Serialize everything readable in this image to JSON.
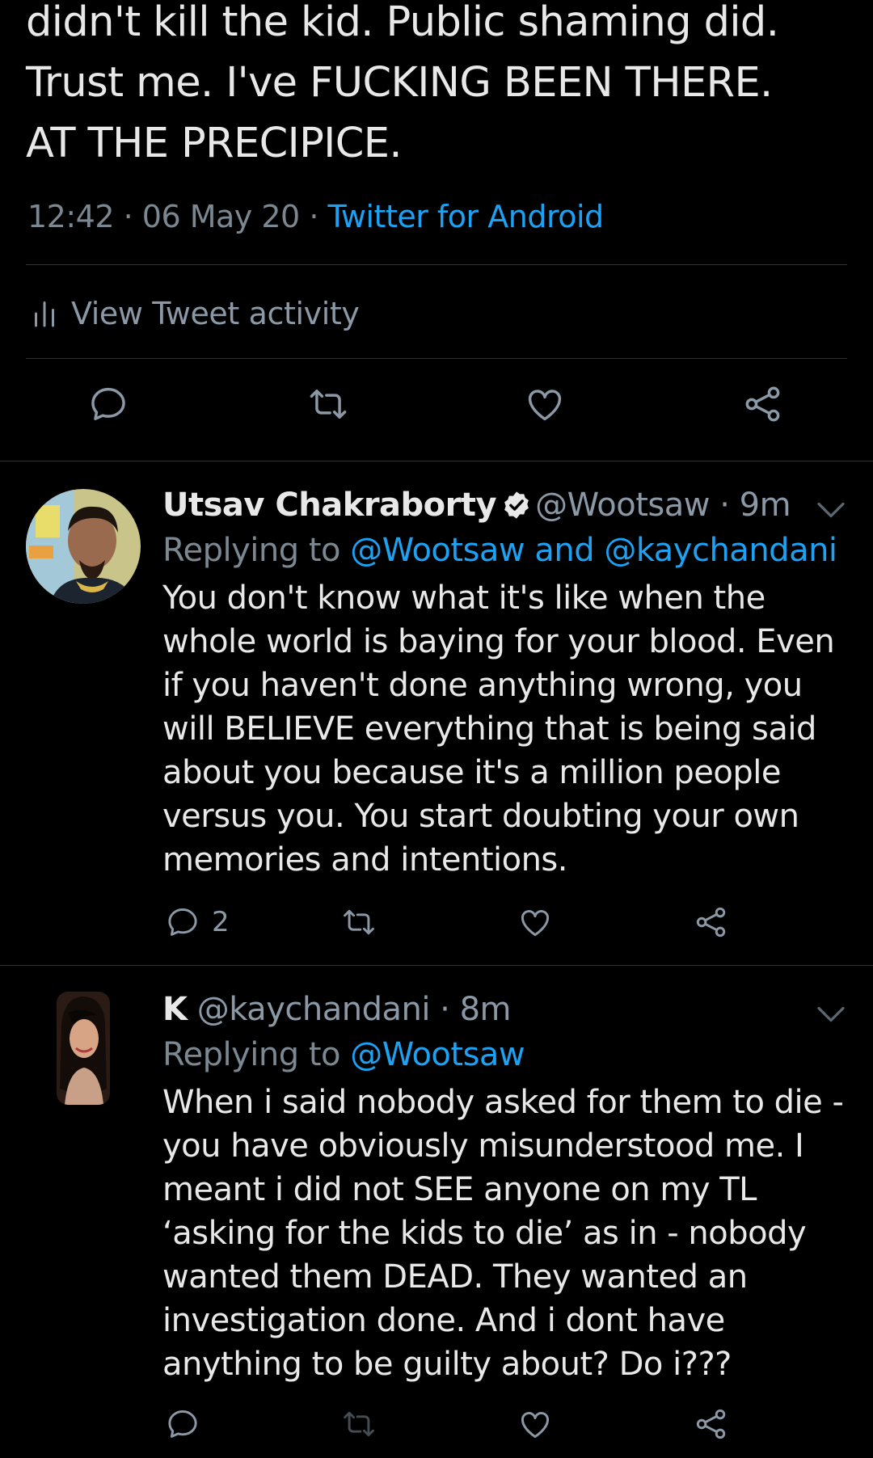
{
  "main_tweet": {
    "text_line1": "didn't kill the kid. Public shaming did.",
    "text_line2": "Trust me. I've FUCKING BEEN THERE.",
    "text_line3": "AT THE PRECIPICE.",
    "time": "12:42",
    "date": "06 May 20",
    "source": "Twitter for Android",
    "activity_label": "View Tweet activity"
  },
  "replies": [
    {
      "display_name": "Utsav Chakraborty",
      "verified": true,
      "handle": "@Wootsaw",
      "time_ago": "9m",
      "replying_prefix": "Replying to",
      "replying_to": "@Wootsaw and @kaychandani",
      "text": "You don't know what it's like when the whole world is baying for your blood. Even if you haven't done anything wrong, you will BELIEVE everything that is being said about you because it's a million people versus you. You start doubting your own memories and intentions.",
      "reply_count": "2"
    },
    {
      "display_name": "K",
      "verified": false,
      "handle": "@kaychandani",
      "time_ago": "8m",
      "replying_prefix": "Replying to",
      "replying_to": "@Wootsaw",
      "text": "When i said nobody asked for them to die - you have obviously misunderstood me. I meant i did not SEE anyone on my TL ‘asking for the kids to die’ as in - nobody wanted them DEAD. They wanted an investigation done. And i dont have anything to be guilty about? Do i???"
    }
  ],
  "icons": [
    "reply-icon",
    "retweet-icon",
    "like-icon",
    "share-icon",
    "activity-bars-icon",
    "verified-badge-icon",
    "chevron-down-icon"
  ],
  "colors": {
    "background": "#000000",
    "text": "#e8e8e8",
    "secondary": "#8b98a5",
    "link": "#1da1f2",
    "divider": "#2f3336"
  }
}
